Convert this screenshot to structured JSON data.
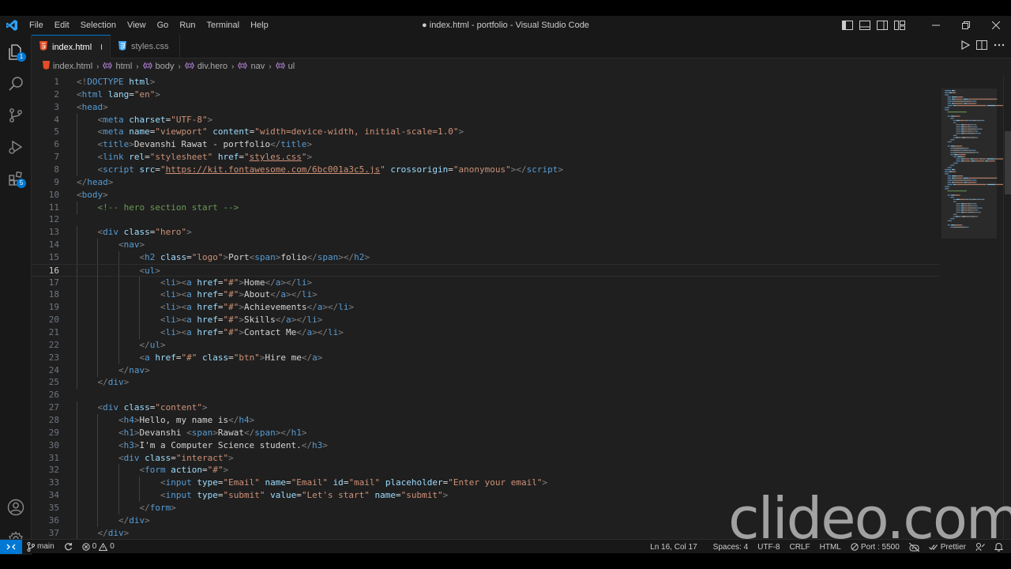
{
  "colors": {
    "accent": "#0078d4",
    "editor_bg": "#1f1f1f",
    "chrome_bg": "#181818"
  },
  "titlebar": {
    "menu": [
      "File",
      "Edit",
      "Selection",
      "View",
      "Go",
      "Run",
      "Terminal",
      "Help"
    ],
    "title": "● index.html - portfolio - Visual Studio Code"
  },
  "activitybar": {
    "explorer_badge": "1",
    "extensions_badge": "5"
  },
  "tabs": [
    {
      "label": "index.html",
      "icon": "html5-icon",
      "dirty": true,
      "active": true
    },
    {
      "label": "styles.css",
      "icon": "css3-icon",
      "dirty": false,
      "active": false
    }
  ],
  "breadcrumb": [
    "index.html",
    "html",
    "body",
    "div.hero",
    "nav",
    "ul"
  ],
  "editor": {
    "current_line": 16,
    "lines": [
      [
        [
          "p",
          "<!"
        ],
        [
          "t",
          "DOCTYPE"
        ],
        [
          "txt",
          " "
        ],
        [
          "a",
          "html"
        ],
        [
          "p",
          ">"
        ]
      ],
      [
        [
          "p",
          "<"
        ],
        [
          "t",
          "html"
        ],
        [
          "txt",
          " "
        ],
        [
          "a",
          "lang"
        ],
        [
          "txt",
          "="
        ],
        [
          "s",
          "\"en\""
        ],
        [
          "p",
          ">"
        ]
      ],
      [
        [
          "p",
          "<"
        ],
        [
          "t",
          "head"
        ],
        [
          "p",
          ">"
        ]
      ],
      [
        [
          "txt",
          "    "
        ],
        [
          "p",
          "<"
        ],
        [
          "t",
          "meta"
        ],
        [
          "txt",
          " "
        ],
        [
          "a",
          "charset"
        ],
        [
          "txt",
          "="
        ],
        [
          "s",
          "\"UTF-8\""
        ],
        [
          "p",
          ">"
        ]
      ],
      [
        [
          "txt",
          "    "
        ],
        [
          "p",
          "<"
        ],
        [
          "t",
          "meta"
        ],
        [
          "txt",
          " "
        ],
        [
          "a",
          "name"
        ],
        [
          "txt",
          "="
        ],
        [
          "s",
          "\"viewport\""
        ],
        [
          "txt",
          " "
        ],
        [
          "a",
          "content"
        ],
        [
          "txt",
          "="
        ],
        [
          "s",
          "\"width=device-width, initial-scale=1.0\""
        ],
        [
          "p",
          ">"
        ]
      ],
      [
        [
          "txt",
          "    "
        ],
        [
          "p",
          "<"
        ],
        [
          "t",
          "title"
        ],
        [
          "p",
          ">"
        ],
        [
          "txt",
          "Devanshi Rawat - portfolio"
        ],
        [
          "p",
          "</"
        ],
        [
          "t",
          "title"
        ],
        [
          "p",
          ">"
        ]
      ],
      [
        [
          "txt",
          "    "
        ],
        [
          "p",
          "<"
        ],
        [
          "t",
          "link"
        ],
        [
          "txt",
          " "
        ],
        [
          "a",
          "rel"
        ],
        [
          "txt",
          "="
        ],
        [
          "s",
          "\"stylesheet\""
        ],
        [
          "txt",
          " "
        ],
        [
          "a",
          "href"
        ],
        [
          "txt",
          "="
        ],
        [
          "s",
          "\""
        ],
        [
          "su",
          "styles.css"
        ],
        [
          "s",
          "\""
        ],
        [
          "p",
          ">"
        ]
      ],
      [
        [
          "txt",
          "    "
        ],
        [
          "p",
          "<"
        ],
        [
          "t",
          "script"
        ],
        [
          "txt",
          " "
        ],
        [
          "a",
          "src"
        ],
        [
          "txt",
          "="
        ],
        [
          "s",
          "\""
        ],
        [
          "su",
          "https://kit.fontawesome.com/6bc001a3c5.js"
        ],
        [
          "s",
          "\""
        ],
        [
          "txt",
          " "
        ],
        [
          "a",
          "crossorigin"
        ],
        [
          "txt",
          "="
        ],
        [
          "s",
          "\"anonymous\""
        ],
        [
          "p",
          "></"
        ],
        [
          "t",
          "script"
        ],
        [
          "p",
          ">"
        ]
      ],
      [
        [
          "p",
          "</"
        ],
        [
          "t",
          "head"
        ],
        [
          "p",
          ">"
        ]
      ],
      [
        [
          "p",
          "<"
        ],
        [
          "t",
          "body"
        ],
        [
          "p",
          ">"
        ]
      ],
      [
        [
          "txt",
          "    "
        ],
        [
          "c",
          "<!-- hero section start -->"
        ]
      ],
      [
        [
          "txt",
          ""
        ]
      ],
      [
        [
          "txt",
          "    "
        ],
        [
          "p",
          "<"
        ],
        [
          "t",
          "div"
        ],
        [
          "txt",
          " "
        ],
        [
          "a",
          "class"
        ],
        [
          "txt",
          "="
        ],
        [
          "s",
          "\"hero\""
        ],
        [
          "p",
          ">"
        ]
      ],
      [
        [
          "txt",
          "        "
        ],
        [
          "p",
          "<"
        ],
        [
          "t",
          "nav"
        ],
        [
          "p",
          ">"
        ]
      ],
      [
        [
          "txt",
          "            "
        ],
        [
          "p",
          "<"
        ],
        [
          "t",
          "h2"
        ],
        [
          "txt",
          " "
        ],
        [
          "a",
          "class"
        ],
        [
          "txt",
          "="
        ],
        [
          "s",
          "\"logo\""
        ],
        [
          "p",
          ">"
        ],
        [
          "txt",
          "Port"
        ],
        [
          "p",
          "<"
        ],
        [
          "t",
          "span"
        ],
        [
          "p",
          ">"
        ],
        [
          "txt",
          "folio"
        ],
        [
          "p",
          "</"
        ],
        [
          "t",
          "span"
        ],
        [
          "p",
          "></"
        ],
        [
          "t",
          "h2"
        ],
        [
          "p",
          ">"
        ]
      ],
      [
        [
          "txt",
          "            "
        ],
        [
          "p",
          "<"
        ],
        [
          "t",
          "ul"
        ],
        [
          "p",
          ">"
        ]
      ],
      [
        [
          "txt",
          "                "
        ],
        [
          "p",
          "<"
        ],
        [
          "t",
          "li"
        ],
        [
          "p",
          "><"
        ],
        [
          "t",
          "a"
        ],
        [
          "txt",
          " "
        ],
        [
          "a",
          "href"
        ],
        [
          "txt",
          "="
        ],
        [
          "s",
          "\"#\""
        ],
        [
          "p",
          ">"
        ],
        [
          "txt",
          "Home"
        ],
        [
          "p",
          "</"
        ],
        [
          "t",
          "a"
        ],
        [
          "p",
          "></"
        ],
        [
          "t",
          "li"
        ],
        [
          "p",
          ">"
        ]
      ],
      [
        [
          "txt",
          "                "
        ],
        [
          "p",
          "<"
        ],
        [
          "t",
          "li"
        ],
        [
          "p",
          "><"
        ],
        [
          "t",
          "a"
        ],
        [
          "txt",
          " "
        ],
        [
          "a",
          "href"
        ],
        [
          "txt",
          "="
        ],
        [
          "s",
          "\"#\""
        ],
        [
          "p",
          ">"
        ],
        [
          "txt",
          "About"
        ],
        [
          "p",
          "</"
        ],
        [
          "t",
          "a"
        ],
        [
          "p",
          "></"
        ],
        [
          "t",
          "li"
        ],
        [
          "p",
          ">"
        ]
      ],
      [
        [
          "txt",
          "                "
        ],
        [
          "p",
          "<"
        ],
        [
          "t",
          "li"
        ],
        [
          "p",
          "><"
        ],
        [
          "t",
          "a"
        ],
        [
          "txt",
          " "
        ],
        [
          "a",
          "href"
        ],
        [
          "txt",
          "="
        ],
        [
          "s",
          "\"#\""
        ],
        [
          "p",
          ">"
        ],
        [
          "txt",
          "Achievements"
        ],
        [
          "p",
          "</"
        ],
        [
          "t",
          "a"
        ],
        [
          "p",
          "></"
        ],
        [
          "t",
          "li"
        ],
        [
          "p",
          ">"
        ]
      ],
      [
        [
          "txt",
          "                "
        ],
        [
          "p",
          "<"
        ],
        [
          "t",
          "li"
        ],
        [
          "p",
          "><"
        ],
        [
          "t",
          "a"
        ],
        [
          "txt",
          " "
        ],
        [
          "a",
          "href"
        ],
        [
          "txt",
          "="
        ],
        [
          "s",
          "\"#\""
        ],
        [
          "p",
          ">"
        ],
        [
          "txt",
          "Skills"
        ],
        [
          "p",
          "</"
        ],
        [
          "t",
          "a"
        ],
        [
          "p",
          "></"
        ],
        [
          "t",
          "li"
        ],
        [
          "p",
          ">"
        ]
      ],
      [
        [
          "txt",
          "                "
        ],
        [
          "p",
          "<"
        ],
        [
          "t",
          "li"
        ],
        [
          "p",
          "><"
        ],
        [
          "t",
          "a"
        ],
        [
          "txt",
          " "
        ],
        [
          "a",
          "href"
        ],
        [
          "txt",
          "="
        ],
        [
          "s",
          "\"#\""
        ],
        [
          "p",
          ">"
        ],
        [
          "txt",
          "Contact Me"
        ],
        [
          "p",
          "</"
        ],
        [
          "t",
          "a"
        ],
        [
          "p",
          "></"
        ],
        [
          "t",
          "li"
        ],
        [
          "p",
          ">"
        ]
      ],
      [
        [
          "txt",
          "            "
        ],
        [
          "p",
          "</"
        ],
        [
          "t",
          "ul"
        ],
        [
          "p",
          ">"
        ]
      ],
      [
        [
          "txt",
          "            "
        ],
        [
          "p",
          "<"
        ],
        [
          "t",
          "a"
        ],
        [
          "txt",
          " "
        ],
        [
          "a",
          "href"
        ],
        [
          "txt",
          "="
        ],
        [
          "s",
          "\"#\""
        ],
        [
          "txt",
          " "
        ],
        [
          "a",
          "class"
        ],
        [
          "txt",
          "="
        ],
        [
          "s",
          "\"btn\""
        ],
        [
          "p",
          ">"
        ],
        [
          "txt",
          "Hire me"
        ],
        [
          "p",
          "</"
        ],
        [
          "t",
          "a"
        ],
        [
          "p",
          ">"
        ]
      ],
      [
        [
          "txt",
          "        "
        ],
        [
          "p",
          "</"
        ],
        [
          "t",
          "nav"
        ],
        [
          "p",
          ">"
        ]
      ],
      [
        [
          "txt",
          "    "
        ],
        [
          "p",
          "</"
        ],
        [
          "t",
          "div"
        ],
        [
          "p",
          ">"
        ]
      ],
      [
        [
          "txt",
          ""
        ]
      ],
      [
        [
          "txt",
          "    "
        ],
        [
          "p",
          "<"
        ],
        [
          "t",
          "div"
        ],
        [
          "txt",
          " "
        ],
        [
          "a",
          "class"
        ],
        [
          "txt",
          "="
        ],
        [
          "s",
          "\"content\""
        ],
        [
          "p",
          ">"
        ]
      ],
      [
        [
          "txt",
          "        "
        ],
        [
          "p",
          "<"
        ],
        [
          "t",
          "h4"
        ],
        [
          "p",
          ">"
        ],
        [
          "txt",
          "Hello, my name is"
        ],
        [
          "p",
          "</"
        ],
        [
          "t",
          "h4"
        ],
        [
          "p",
          ">"
        ]
      ],
      [
        [
          "txt",
          "        "
        ],
        [
          "p",
          "<"
        ],
        [
          "t",
          "h1"
        ],
        [
          "p",
          ">"
        ],
        [
          "txt",
          "Devanshi "
        ],
        [
          "p",
          "<"
        ],
        [
          "t",
          "span"
        ],
        [
          "p",
          ">"
        ],
        [
          "txt",
          "Rawat"
        ],
        [
          "p",
          "</"
        ],
        [
          "t",
          "span"
        ],
        [
          "p",
          "></"
        ],
        [
          "t",
          "h1"
        ],
        [
          "p",
          ">"
        ]
      ],
      [
        [
          "txt",
          "        "
        ],
        [
          "p",
          "<"
        ],
        [
          "t",
          "h3"
        ],
        [
          "p",
          ">"
        ],
        [
          "txt",
          "I'm a Computer Science student."
        ],
        [
          "p",
          "</"
        ],
        [
          "t",
          "h3"
        ],
        [
          "p",
          ">"
        ]
      ],
      [
        [
          "txt",
          "        "
        ],
        [
          "p",
          "<"
        ],
        [
          "t",
          "div"
        ],
        [
          "txt",
          " "
        ],
        [
          "a",
          "class"
        ],
        [
          "txt",
          "="
        ],
        [
          "s",
          "\"interact\""
        ],
        [
          "p",
          ">"
        ]
      ],
      [
        [
          "txt",
          "            "
        ],
        [
          "p",
          "<"
        ],
        [
          "t",
          "form"
        ],
        [
          "txt",
          " "
        ],
        [
          "a",
          "action"
        ],
        [
          "txt",
          "="
        ],
        [
          "s",
          "\"#\""
        ],
        [
          "p",
          ">"
        ]
      ],
      [
        [
          "txt",
          "                "
        ],
        [
          "p",
          "<"
        ],
        [
          "t",
          "input"
        ],
        [
          "txt",
          " "
        ],
        [
          "a",
          "type"
        ],
        [
          "txt",
          "="
        ],
        [
          "s",
          "\"Email\""
        ],
        [
          "txt",
          " "
        ],
        [
          "a",
          "name"
        ],
        [
          "txt",
          "="
        ],
        [
          "s",
          "\"Email\""
        ],
        [
          "txt",
          " "
        ],
        [
          "a",
          "id"
        ],
        [
          "txt",
          "="
        ],
        [
          "s",
          "\"mail\""
        ],
        [
          "txt",
          " "
        ],
        [
          "a",
          "placeholder"
        ],
        [
          "txt",
          "="
        ],
        [
          "s",
          "\"Enter your email\""
        ],
        [
          "p",
          ">"
        ]
      ],
      [
        [
          "txt",
          "                "
        ],
        [
          "p",
          "<"
        ],
        [
          "t",
          "input"
        ],
        [
          "txt",
          " "
        ],
        [
          "a",
          "type"
        ],
        [
          "txt",
          "="
        ],
        [
          "s",
          "\"submit\""
        ],
        [
          "txt",
          " "
        ],
        [
          "a",
          "value"
        ],
        [
          "txt",
          "="
        ],
        [
          "s",
          "\"Let's start\""
        ],
        [
          "txt",
          " "
        ],
        [
          "a",
          "name"
        ],
        [
          "txt",
          "="
        ],
        [
          "s",
          "\"submit\""
        ],
        [
          "p",
          ">"
        ]
      ],
      [
        [
          "txt",
          "            "
        ],
        [
          "p",
          "</"
        ],
        [
          "t",
          "form"
        ],
        [
          "p",
          ">"
        ]
      ],
      [
        [
          "txt",
          "        "
        ],
        [
          "p",
          "</"
        ],
        [
          "t",
          "div"
        ],
        [
          "p",
          ">"
        ]
      ],
      [
        [
          "txt",
          "    "
        ],
        [
          "p",
          "</"
        ],
        [
          "t",
          "div"
        ],
        [
          "p",
          ">"
        ]
      ]
    ]
  },
  "statusbar": {
    "branch": "main",
    "errors": "0",
    "warnings": "0",
    "position": "Ln 16, Col 17",
    "spaces": "Spaces: 4",
    "encoding": "UTF-8",
    "eol": "CRLF",
    "language": "HTML",
    "port": "Port : 5500",
    "prettier": "Prettier"
  },
  "watermark": "clideo.com"
}
